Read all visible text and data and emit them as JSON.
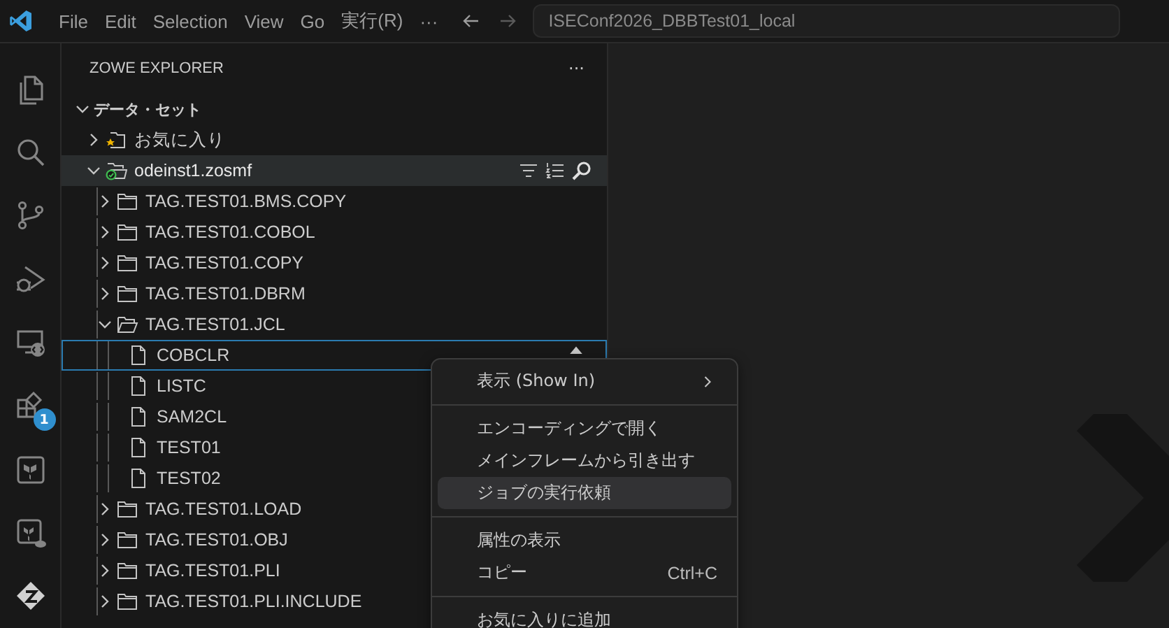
{
  "menu_bar": {
    "items": [
      "File",
      "Edit",
      "Selection",
      "View",
      "Go",
      "実行(R)"
    ],
    "more": "···",
    "search": "ISEConf2026_DBBTest01_local"
  },
  "activity_bar": {
    "items": [
      {
        "kind": "files"
      },
      {
        "kind": "search"
      },
      {
        "kind": "source-control"
      },
      {
        "kind": "debug"
      },
      {
        "kind": "remote"
      },
      {
        "kind": "extensions",
        "badge": "1"
      },
      {
        "kind": "terraform"
      },
      {
        "kind": "terraform-cloud"
      },
      {
        "kind": "zowe"
      }
    ]
  },
  "sidebar": {
    "title": "ZOWE EXPLORER",
    "more": "···",
    "tree": [
      {
        "label": "データ・セット",
        "kind": "section",
        "expanded": true,
        "selected": false,
        "children": [
          {
            "label": "お気に入り",
            "kind": "favorites",
            "expanded": false,
            "selected": false
          },
          {
            "label": "odeinst1.zosmf",
            "kind": "profile",
            "expanded": true,
            "selected": false,
            "hovered": true,
            "children": [
              {
                "label": "TAG.TEST01.BMS.COPY",
                "kind": "dataset",
                "expanded": false,
                "selected": false
              },
              {
                "label": "TAG.TEST01.COBOL",
                "kind": "dataset",
                "expanded": false,
                "selected": false
              },
              {
                "label": "TAG.TEST01.COPY",
                "kind": "dataset",
                "expanded": false,
                "selected": false
              },
              {
                "label": "TAG.TEST01.DBRM",
                "kind": "dataset",
                "expanded": false,
                "selected": false
              },
              {
                "label": "TAG.TEST01.JCL",
                "kind": "dataset",
                "expanded": true,
                "selected": false,
                "children": [
                  {
                    "label": "COBCLR",
                    "kind": "member",
                    "selected": true
                  },
                  {
                    "label": "LISTC",
                    "kind": "member",
                    "selected": false
                  },
                  {
                    "label": "SAM2CL",
                    "kind": "member",
                    "selected": false
                  },
                  {
                    "label": "TEST01",
                    "kind": "member",
                    "selected": false
                  },
                  {
                    "label": "TEST02",
                    "kind": "member",
                    "selected": false
                  }
                ]
              },
              {
                "label": "TAG.TEST01.LOAD",
                "kind": "dataset",
                "expanded": false,
                "selected": false
              },
              {
                "label": "TAG.TEST01.OBJ",
                "kind": "dataset",
                "expanded": false,
                "selected": false
              },
              {
                "label": "TAG.TEST01.PLI",
                "kind": "dataset",
                "expanded": false,
                "selected": false
              },
              {
                "label": "TAG.TEST01.PLI.INCLUDE",
                "kind": "dataset",
                "expanded": false,
                "selected": false
              }
            ]
          }
        ]
      }
    ]
  },
  "context_menu": {
    "items": [
      {
        "kind": "submenu",
        "label": "表示 (Show In)",
        "hovered": false
      },
      {
        "kind": "separator"
      },
      {
        "kind": "item",
        "label": "エンコーディングで開く",
        "hovered": false
      },
      {
        "kind": "item",
        "label": "メインフレームから引き出す",
        "hovered": false
      },
      {
        "kind": "item",
        "label": "ジョブの実行依頼",
        "hovered": true
      },
      {
        "kind": "separator"
      },
      {
        "kind": "item",
        "label": "属性の表示",
        "hovered": false
      },
      {
        "kind": "item",
        "label": "コピー",
        "shortcut": "Ctrl+C",
        "hovered": false
      },
      {
        "kind": "separator"
      },
      {
        "kind": "item",
        "label": "お気に入りに追加",
        "hovered": false
      }
    ]
  }
}
